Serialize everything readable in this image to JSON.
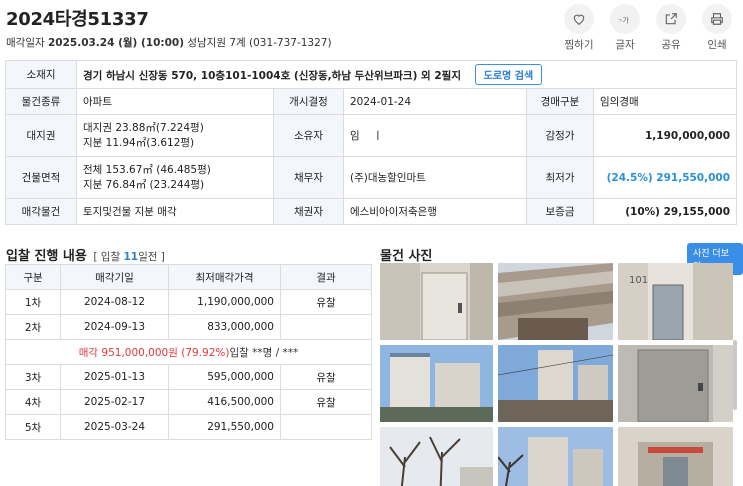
{
  "header": {
    "case_no": "2024타경51337",
    "sale_date_label": "매각일자",
    "sale_date": "2025.03.24 (월) (10:00)",
    "court": "성남지원 7계 (031-737-1327)"
  },
  "actions": [
    {
      "label": "찜하기",
      "icon": "heart-icon"
    },
    {
      "label": "글자",
      "icon": "font-size-icon"
    },
    {
      "label": "공유",
      "icon": "share-icon"
    },
    {
      "label": "인쇄",
      "icon": "print-icon"
    }
  ],
  "info": {
    "location_label": "소재지",
    "location": "경기 하남시 신장동 570, 10층101-1004호 (신장동,하남 두산위브파크) 외 2필지",
    "road_button": "도로명 검색",
    "type_label": "물건종류",
    "type": "아파트",
    "start_label": "개시결정",
    "start": "2024-01-24",
    "auction_label": "경매구분",
    "auction": "임의경매",
    "land_label": "대지권",
    "land_1": "대지권 23.88㎡(7.224평)",
    "land_2": "지분 11.94㎡(3.612평)",
    "owner_label": "소유자",
    "owner": "임    ㅣ",
    "appraisal_label": "감정가",
    "appraisal": "1,190,000,000",
    "building_label": "건물면적",
    "building_1": "전체 153.67㎡ (46.485평)",
    "building_2": "지분 76.84㎡ (23.244평)",
    "debtor_label": "채무자",
    "debtor": "(주)대농할인마트",
    "minimum_label": "최저가",
    "minimum": "(24.5%) 291,550,000",
    "item_label": "매각물건",
    "item": "토지및건물 지분 매각",
    "creditor_label": "채권자",
    "creditor": "에스비아이저축은행",
    "deposit_label": "보증금",
    "deposit": "(10%) 29,155,000"
  },
  "bids": {
    "title": "입찰 진행 내용",
    "bracket_pre": "[ 입찰",
    "days": "11",
    "bracket_post": "일전 ]",
    "headers": [
      "구분",
      "매각기일",
      "최저매각가격",
      "결과"
    ],
    "rows": [
      {
        "round": "1차",
        "date": "2024-08-12",
        "price": "1,190,000,000",
        "result": "유찰"
      },
      {
        "round": "2차",
        "date": "2024-09-13",
        "price": "833,000,000",
        "result": ""
      },
      {
        "round": "3차",
        "date": "2025-01-13",
        "price": "595,000,000",
        "result": "유찰"
      },
      {
        "round": "4차",
        "date": "2025-02-17",
        "price": "416,500,000",
        "result": "유찰"
      },
      {
        "round": "5차",
        "date": "2025-03-24",
        "price": "291,550,000",
        "result": ""
      }
    ],
    "sale_note_red": "매각 951,000,000원 (79.92%)",
    "sale_note_rest": "입찰 **명 / ***"
  },
  "photos": {
    "title": "물건 사진",
    "more_button": "사진 더보기"
  },
  "colors": {
    "accent": "#3a8ee6",
    "header_bg": "#f3f6fa",
    "highlight_blue": "#2a90d9",
    "highlight_red": "#e03a3a"
  }
}
